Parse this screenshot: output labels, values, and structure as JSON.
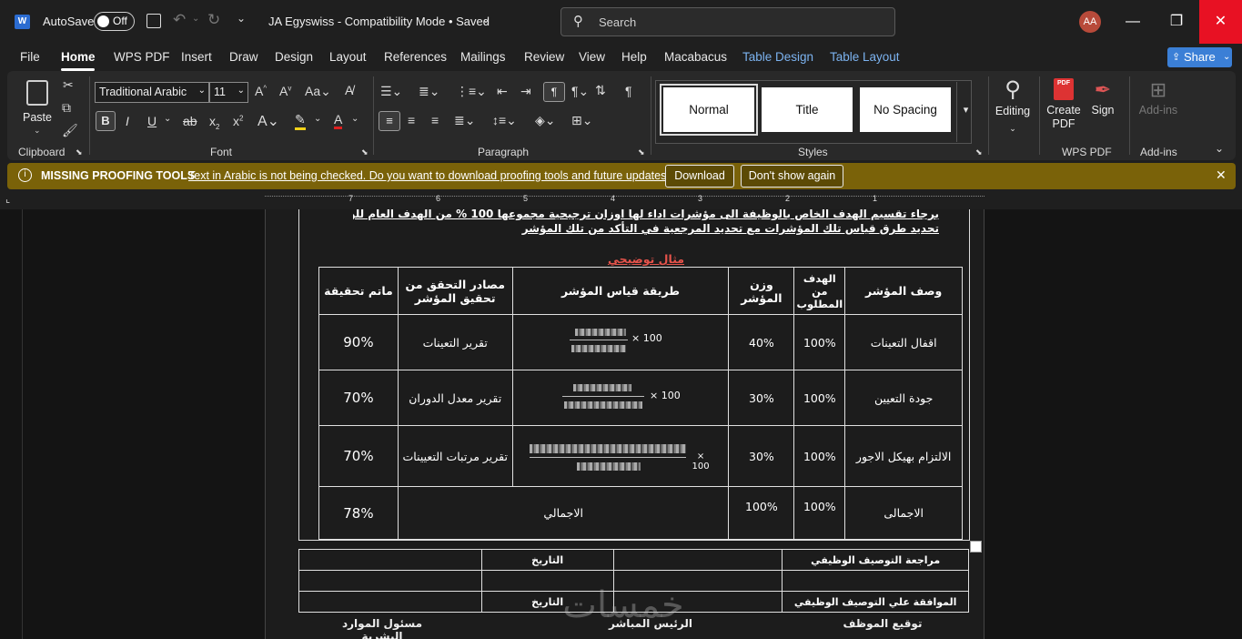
{
  "titlebar": {
    "autosave_label": "AutoSave",
    "autosave_state": "Off",
    "doc_title": "JA Egyswiss  -  Compatibility Mode • Saved",
    "search_placeholder": "Search",
    "user_initials": "AA"
  },
  "tabs": [
    "File",
    "Home",
    "WPS PDF",
    "Insert",
    "Draw",
    "Design",
    "Layout",
    "References",
    "Mailings",
    "Review",
    "View",
    "Help",
    "Macabacus",
    "Table Design",
    "Table Layout"
  ],
  "share_label": "Share",
  "ribbon": {
    "clipboard": {
      "paste": "Paste",
      "group": "Clipboard"
    },
    "font": {
      "family": "Traditional Arabic",
      "size": "11",
      "group": "Font"
    },
    "paragraph": {
      "group": "Paragraph"
    },
    "styles": {
      "items": [
        "Normal",
        "Title",
        "No Spacing"
      ],
      "group": "Styles"
    },
    "editing": {
      "label": "Editing"
    },
    "wps": {
      "create_pdf": "Create PDF",
      "sign": "Sign",
      "group": "WPS PDF"
    },
    "addins": {
      "label": "Add-ins",
      "group": "Add-ins"
    }
  },
  "message_bar": {
    "title": "MISSING PROOFING TOOLS",
    "text": "Text in Arabic is not being checked. Do you want to download proofing tools and future updates?",
    "download": "Download",
    "dont_show": "Don't show again"
  },
  "ruler": [
    "7",
    "6",
    "5",
    "4",
    "3",
    "2",
    "1"
  ],
  "document": {
    "line1": "برجاء تقسيم الهدف الخاص بالوظيفة الى مؤشرات اداء لها أوزان ترجيحية مجموعها 100 % من الهدف العام للوظيفة , يسهل قياسها مع",
    "line2": "تحديد طرق قياس تلك المؤشرات مع تحديد المرجعية في التأكد من تلك المؤشر",
    "example_title": "مثال توضيحي",
    "headers": [
      "وصف المؤشر",
      "الهدف من المطلوب",
      "وزن المؤشر",
      "طريقة قياس المؤشر",
      "مصادر التحقق من تحقيق المؤشر",
      "ماتم تحقيقة"
    ],
    "rows": [
      {
        "desc": "اقفال التعينات",
        "target": "100%",
        "weight": "40%",
        "source": "تقرير التعينات",
        "achieved": "90%",
        "mult": "× 100"
      },
      {
        "desc": "جودة التعيين",
        "target": "100%",
        "weight": "30%",
        "source": "تقرير معدل الدوران",
        "achieved": "70%",
        "mult": "× 100"
      },
      {
        "desc": "الالتزام بهيكل الاجور",
        "target": "100%",
        "weight": "30%",
        "source": "تقرير مرتبات التعيينات",
        "achieved": "70%",
        "mult": "× 100"
      }
    ],
    "total": {
      "desc": "الاجمالى",
      "target": "100%",
      "weight": "100%",
      "label": "الاجمالي",
      "achieved": "78%"
    },
    "sig": {
      "r1c1": "مراجعة التوصيف الوظيفي",
      "r1c3": "التاريخ",
      "r3c1": "الموافقة علي التوصيف الوظيفي",
      "r3c3": "التاريخ",
      "f1": "توقيع الموظف",
      "f2": "الرئيس المباشر",
      "f3": "مسئول الموارد البشرية"
    },
    "watermark": "خمسات"
  }
}
